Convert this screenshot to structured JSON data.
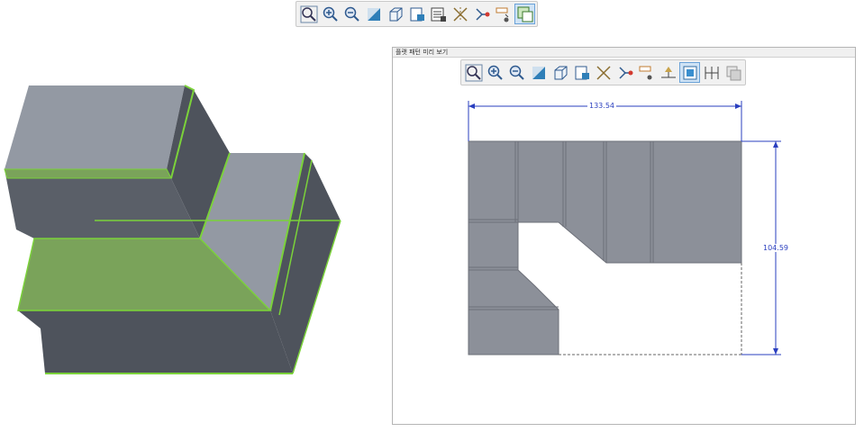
{
  "colors": {
    "dimension": "#2a3fbf",
    "highlight": "#7bd23a",
    "face_light": "#9399a3",
    "face_dark": "#4e535c",
    "face_green": "#7aa35a"
  },
  "main_toolbar": {
    "icons": [
      "zoom-fit-icon",
      "zoom-in-icon",
      "zoom-out-icon",
      "repaint-icon",
      "view-orientation-icon",
      "display-style-icon",
      "named-views-icon",
      "datum-display-icon",
      "annotation-display-icon",
      "spin-center-icon",
      "appearance-icon",
      "flat-pattern-preview-icon"
    ]
  },
  "preview_window": {
    "title": "플랫 패턴 미리 보기",
    "toolbar_icons": [
      "zoom-fit-icon",
      "zoom-in-icon",
      "zoom-out-icon",
      "repaint-icon",
      "view-orientation-icon",
      "display-style-icon",
      "datum-display-icon",
      "spin-center-icon",
      "annotation-display-icon",
      "bend-lines-icon",
      "fixed-geometry-icon",
      "dimension-icon",
      "overlay-icon"
    ],
    "dimensions": {
      "width": "133.54",
      "height": "104.59"
    }
  }
}
